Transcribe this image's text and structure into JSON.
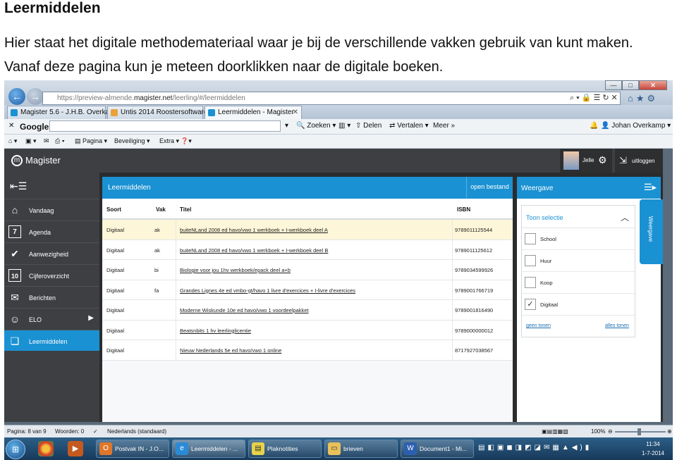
{
  "document": {
    "heading": "Leermiddelen",
    "paragraph_1": "Hier staat het digitale methodemateriaal waar je bij de verschillende vakken gebruik van kunt maken.",
    "paragraph_2": "Vanaf deze pagina kun je meteen doorklikken naar de digitale boeken."
  },
  "browser": {
    "url_prefix": "https://preview-almende.",
    "url_host": "magister.net",
    "url_path": "/leerling/#/leermiddelen",
    "tabs": [
      {
        "label": "Magister 5.6 - J.H.B. Overkamp",
        "favicon_color": "#1a91d2"
      },
      {
        "label": "Untis 2014 Roostersoftware",
        "favicon_color": "#e8a23a"
      },
      {
        "label": "Leermiddelen - Magister",
        "favicon_color": "#1a91d2"
      }
    ],
    "google_label": "Google",
    "toolbar_zoeken": "Zoeken",
    "toolbar_delen": "Delen",
    "toolbar_vertalen": "Vertalen",
    "toolbar_meer": "Meer »",
    "account_name": "Johan Overkamp",
    "cmd_pagina": "Pagina",
    "cmd_beveiliging": "Beveiliging",
    "cmd_extra": "Extra"
  },
  "app": {
    "logo_text": "Magister",
    "user_name": "Jelle",
    "logout_label": "uitloggen",
    "sidebar": [
      {
        "label": "Vandaag",
        "icon": "home-icon",
        "glyph": "⌂"
      },
      {
        "label": "Agenda",
        "icon": "calendar-icon",
        "glyph": "7"
      },
      {
        "label": "Aanwezigheid",
        "icon": "check-icon",
        "glyph": "✔"
      },
      {
        "label": "Cijferoverzicht",
        "icon": "grades-icon",
        "glyph": "10"
      },
      {
        "label": "Berichten",
        "icon": "envelope-icon",
        "glyph": "✉"
      },
      {
        "label": "ELO",
        "icon": "people-icon",
        "glyph": "☺"
      },
      {
        "label": "Leermiddelen",
        "icon": "books-icon",
        "glyph": "❏"
      }
    ],
    "main_title": "Leermiddelen",
    "open_file": "open bestand",
    "columns": {
      "soort": "Soort",
      "vak": "Vak",
      "titel": "Titel",
      "isbn": "ISBN"
    },
    "rows": [
      {
        "soort": "Digitaal",
        "vak": "ak",
        "titel": "buiteNLand 2008 ed havo/vwo 1 werkboek + I-werkboek deel A",
        "isbn": "9789011125544"
      },
      {
        "soort": "Digitaal",
        "vak": "ak",
        "titel": "buiteNLand 2008 ed havo/vwo 1 werkboek + I-werkboek deel B",
        "isbn": "9789011125612"
      },
      {
        "soort": "Digitaal",
        "vak": "bi",
        "titel": "Biologie voor jou 1hv werkboek/epack deel a+b",
        "isbn": "9789034599926"
      },
      {
        "soort": "Digitaal",
        "vak": "fa",
        "titel": "Grandes Lignes 4e ed vmbo-gt/havo 1 livre d'exercices + I-livre d'exercices",
        "isbn": "9789001766719"
      },
      {
        "soort": "Digitaal",
        "vak": "",
        "titel": "Moderne Wiskunde 10e ed havo/vwo 1 voordeelpakket",
        "isbn": "9789001816490"
      },
      {
        "soort": "Digitaal",
        "vak": "",
        "titel": "Beatsnbits 1 hv leerlinglicentie",
        "isbn": "9789000000012"
      },
      {
        "soort": "Digitaal",
        "vak": "",
        "titel": "Nieuw Nederlands 5e ed havo/vwo 1 online",
        "isbn": "8717927038567"
      }
    ],
    "panel_title": "Weergave",
    "side_tab": "Weergave",
    "filter_title": "Toon selectie",
    "filters": [
      {
        "label": "School",
        "checked": false
      },
      {
        "label": "Huur",
        "checked": false
      },
      {
        "label": "Koop",
        "checked": false
      },
      {
        "label": "Digitaal",
        "checked": true
      }
    ],
    "none_link": "geen tonen",
    "all_link": "alles tonen"
  },
  "statusbar": {
    "page": "Pagina: 8 van 9",
    "words": "Woorden: 0",
    "language": "Nederlands (standaard)",
    "zoom": "100%"
  },
  "taskbar": {
    "apps": [
      {
        "label": "Postvak IN - J.O...",
        "icon": "outlook-icon",
        "glyph": "O",
        "color": "#e0762a"
      },
      {
        "label": "Leermiddelen - ...",
        "icon": "ie-icon",
        "glyph": "e",
        "color": "#2b8ad6"
      },
      {
        "label": "Plaknotities",
        "icon": "sticky-notes-icon",
        "glyph": "▤",
        "color": "#e7d24a"
      },
      {
        "label": "brieven",
        "icon": "folder-icon",
        "glyph": "▭",
        "color": "#e8c15a"
      },
      {
        "label": "Document1 - Mi...",
        "icon": "word-icon",
        "glyph": "W",
        "color": "#2d5fb0"
      }
    ],
    "time": "11:34",
    "date": "1-7-2014"
  }
}
